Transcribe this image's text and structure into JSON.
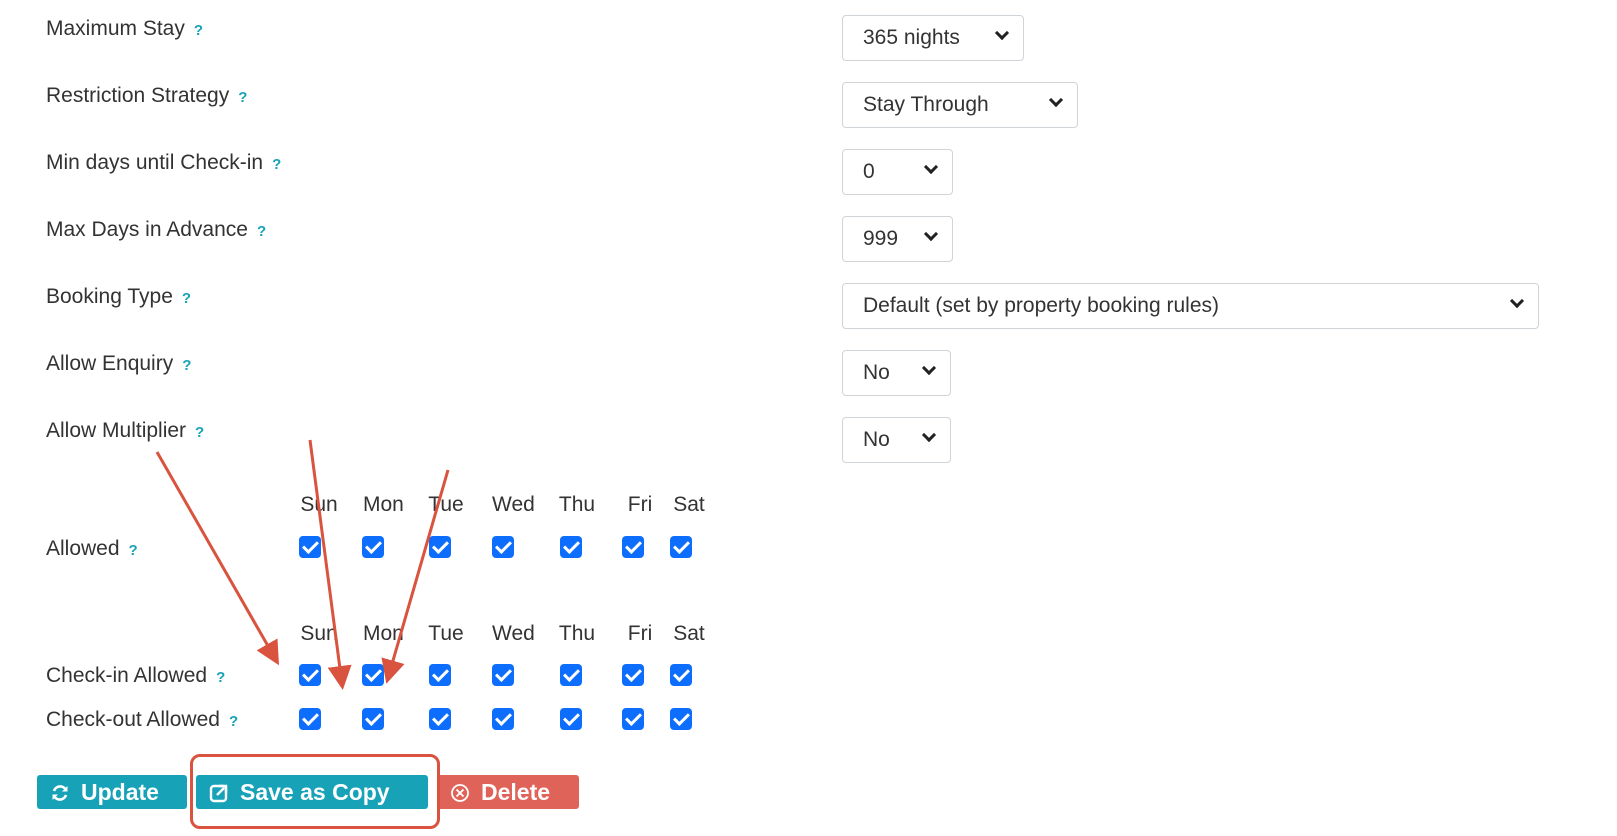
{
  "fields": [
    {
      "label": "Maximum Stay",
      "help": "?",
      "value": "365 nights"
    },
    {
      "label": "Restriction Strategy",
      "help": "?",
      "value": "Stay Through"
    },
    {
      "label": "Min days until Check-in",
      "help": "?",
      "value": "0"
    },
    {
      "label": "Max Days in Advance",
      "help": "?",
      "value": "999"
    },
    {
      "label": "Booking Type",
      "help": "?",
      "value": "Default (set by property booking rules)"
    },
    {
      "label": "Allow Enquiry",
      "help": "?",
      "value": "No"
    },
    {
      "label": "Allow Multiplier",
      "help": "?",
      "value": "No"
    }
  ],
  "days": [
    "Sun",
    "Mon",
    "Tue",
    "Wed",
    "Thu",
    "Fri",
    "Sat"
  ],
  "allowed": {
    "label": "Allowed",
    "help": "?",
    "checked": [
      true,
      true,
      true,
      true,
      true,
      true,
      true
    ]
  },
  "checkin": {
    "label": "Check-in Allowed",
    "help": "?",
    "checked": [
      true,
      true,
      true,
      true,
      true,
      true,
      true
    ]
  },
  "checkout": {
    "label": "Check-out Allowed",
    "help": "?",
    "checked": [
      true,
      true,
      true,
      true,
      true,
      true,
      true
    ]
  },
  "buttons": {
    "update": "Update",
    "save_copy": "Save as Copy",
    "delete": "Delete"
  },
  "colors": {
    "accent": "#17a2b8",
    "checkbox": "#0d6efd",
    "danger": "#e0635a",
    "annotation": "#d9533e"
  },
  "icons": {
    "update": "sync-icon",
    "save_copy": "external-copy-icon",
    "delete": "circle-x-icon"
  }
}
